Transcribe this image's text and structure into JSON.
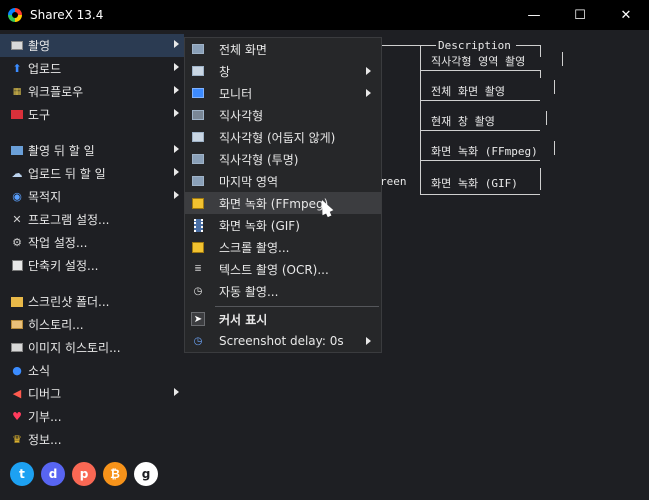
{
  "window": {
    "title": "ShareX 13.4",
    "minimize": "—",
    "maximize": "☐",
    "close": "✕"
  },
  "sidebar": {
    "groups": [
      [
        {
          "label": "촬영",
          "icon": "camera-icon",
          "arrow": true
        },
        {
          "label": "업로드",
          "icon": "upload-arrow-icon",
          "arrow": true
        },
        {
          "label": "워크플로우",
          "icon": "workflow-grid-icon",
          "arrow": true
        },
        {
          "label": "도구",
          "icon": "toolbox-icon",
          "arrow": true
        }
      ],
      [
        {
          "label": "촬영 뒤 할 일",
          "icon": "after-capture-icon",
          "arrow": true
        },
        {
          "label": "업로드 뒤 할 일",
          "icon": "after-upload-icon",
          "arrow": true
        },
        {
          "label": "목적지",
          "icon": "destination-icon",
          "arrow": true
        },
        {
          "label": "프로그램 설정...",
          "icon": "wrench-icon",
          "arrow": false
        },
        {
          "label": "작업 설정...",
          "icon": "gear-icon",
          "arrow": false
        },
        {
          "label": "단축키 설정...",
          "icon": "keyboard-icon",
          "arrow": false
        }
      ],
      [
        {
          "label": "스크린샷 폴더...",
          "icon": "folder-icon",
          "arrow": false
        },
        {
          "label": "히스토리...",
          "icon": "history-icon",
          "arrow": false
        },
        {
          "label": "이미지 히스토리...",
          "icon": "image-history-icon",
          "arrow": false
        },
        {
          "label": "소식",
          "icon": "news-icon",
          "arrow": false
        },
        {
          "label": "디버그",
          "icon": "debug-megaphone-icon",
          "arrow": true
        },
        {
          "label": "기부...",
          "icon": "heart-icon",
          "arrow": false
        },
        {
          "label": "정보...",
          "icon": "crown-icon",
          "arrow": false
        }
      ]
    ]
  },
  "social": [
    {
      "name": "twitter-icon",
      "glyph": "t",
      "color": "#1da1f2"
    },
    {
      "name": "discord-icon",
      "glyph": "d",
      "color": "#5865f2"
    },
    {
      "name": "patreon-icon",
      "glyph": "p",
      "color": "#f96854"
    },
    {
      "name": "bitcoin-icon",
      "glyph": "₿",
      "color": "#f7931a"
    },
    {
      "name": "github-icon",
      "glyph": "g",
      "color": "#ffffff"
    }
  ],
  "diagram": {
    "header": "Description",
    "rows": [
      "직사각형 영역 촬영",
      "전체 화면 촬영",
      "현재 창 촬영",
      "화면 녹화 (FFmpeg)",
      "화면 녹화 (GIF)"
    ],
    "left_fragment": "reen"
  },
  "submenu": {
    "items": [
      {
        "label": "전체 화면",
        "icon": "fullscreen-icon",
        "arrow": false,
        "bold": false
      },
      {
        "label": "창",
        "icon": "window-icon",
        "arrow": true,
        "bold": false
      },
      {
        "label": "모니터",
        "icon": "monitor-icon",
        "arrow": true,
        "bold": false
      },
      {
        "label": "직사각형",
        "icon": "rectangle-icon",
        "arrow": false,
        "bold": false
      },
      {
        "label": "직사각형 (어둡지 않게)",
        "icon": "rectangle-light-icon",
        "arrow": false,
        "bold": false
      },
      {
        "label": "직사각형 (투명)",
        "icon": "rectangle-transparent-icon",
        "arrow": false,
        "bold": false
      },
      {
        "label": "마지막 영역",
        "icon": "last-region-icon",
        "arrow": false,
        "bold": false
      },
      {
        "label": "화면 녹화 (FFmpeg)",
        "icon": "video-record-icon",
        "arrow": false,
        "bold": false,
        "hover": true
      },
      {
        "label": "화면 녹화 (GIF)",
        "icon": "film-gif-icon",
        "arrow": false,
        "bold": false
      },
      {
        "label": "스크롤 촬영...",
        "icon": "scroll-capture-icon",
        "arrow": false,
        "bold": false
      },
      {
        "label": "텍스트 촬영 (OCR)...",
        "icon": "ocr-text-icon",
        "arrow": false,
        "bold": false
      },
      {
        "label": "자동 촬영...",
        "icon": "clock-icon",
        "arrow": false,
        "bold": false
      }
    ],
    "items2": [
      {
        "label": "커서 표시",
        "icon": "cursor-icon",
        "arrow": false,
        "bold": true
      },
      {
        "label": "Screenshot delay: 0s",
        "icon": "delay-clock-icon",
        "arrow": true,
        "bold": false
      }
    ]
  },
  "colors": {
    "background": "#1e1f23",
    "titlebar": "#000000",
    "menu": "#262729",
    "active": "#2b3b52"
  }
}
